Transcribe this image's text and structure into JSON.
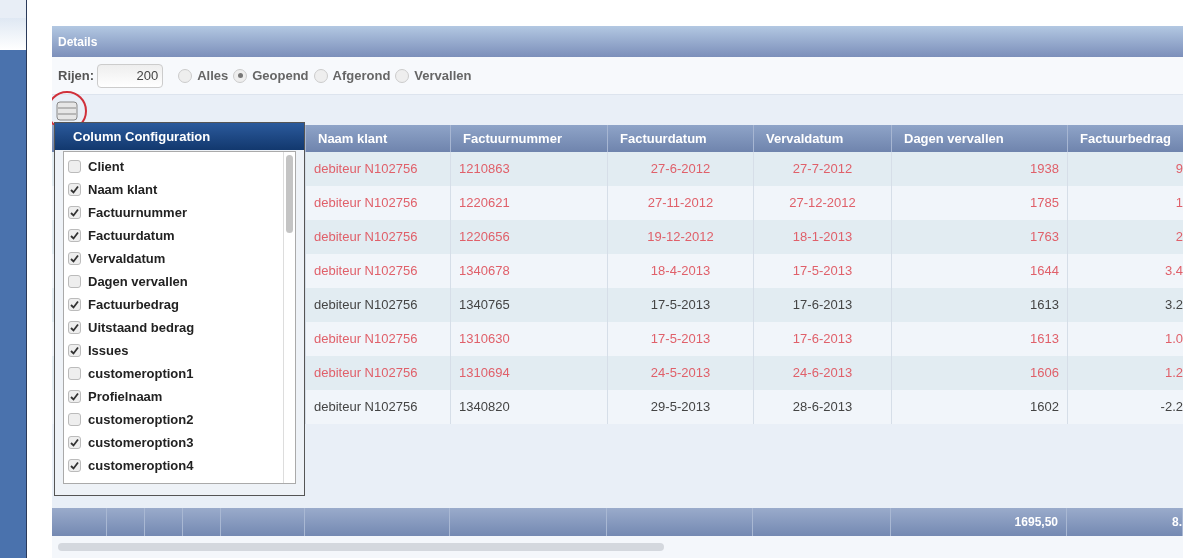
{
  "panel": {
    "title": "Details"
  },
  "toolbar": {
    "rows_label": "Rijen:",
    "rows_value": "200",
    "filters": [
      {
        "label": "Alles",
        "selected": false
      },
      {
        "label": "Geopend",
        "selected": true
      },
      {
        "label": "Afgerond",
        "selected": false
      },
      {
        "label": "Vervallen",
        "selected": false
      }
    ]
  },
  "column_config": {
    "title": "Column Configuration",
    "items": [
      {
        "label": "Client",
        "checked": false
      },
      {
        "label": "Naam klant",
        "checked": true
      },
      {
        "label": "Factuurnummer",
        "checked": true
      },
      {
        "label": "Factuurdatum",
        "checked": true
      },
      {
        "label": "Vervaldatum",
        "checked": true
      },
      {
        "label": "Dagen vervallen",
        "checked": false
      },
      {
        "label": "Factuurbedrag",
        "checked": true
      },
      {
        "label": "Uitstaand bedrag",
        "checked": true
      },
      {
        "label": "Issues",
        "checked": true
      },
      {
        "label": "customeroption1",
        "checked": false
      },
      {
        "label": "Profielnaam",
        "checked": true
      },
      {
        "label": "customeroption2",
        "checked": false
      },
      {
        "label": "customeroption3",
        "checked": true
      },
      {
        "label": "customeroption4",
        "checked": true
      }
    ]
  },
  "table": {
    "columns": [
      "Naam klant",
      "Factuurnummer",
      "Factuurdatum",
      "Vervaldatum",
      "Dagen vervallen",
      "Factuurbedrag"
    ],
    "rows": [
      {
        "alert": true,
        "cells": [
          "debiteur N102756",
          "1210863",
          "27-6-2012",
          "27-7-2012",
          "1938",
          "9"
        ]
      },
      {
        "alert": true,
        "cells": [
          "debiteur N102756",
          "1220621",
          "27-11-2012",
          "27-12-2012",
          "1785",
          "1"
        ]
      },
      {
        "alert": true,
        "cells": [
          "debiteur N102756",
          "1220656",
          "19-12-2012",
          "18-1-2013",
          "1763",
          "2"
        ]
      },
      {
        "alert": true,
        "cells": [
          "debiteur N102756",
          "1340678",
          "18-4-2013",
          "17-5-2013",
          "1644",
          "3.4"
        ]
      },
      {
        "alert": false,
        "cells": [
          "debiteur N102756",
          "1340765",
          "17-5-2013",
          "17-6-2013",
          "1613",
          "3.2"
        ]
      },
      {
        "alert": true,
        "cells": [
          "debiteur N102756",
          "1310630",
          "17-5-2013",
          "17-6-2013",
          "1613",
          "1.0"
        ]
      },
      {
        "alert": true,
        "cells": [
          "debiteur N102756",
          "1310694",
          "24-5-2013",
          "24-6-2013",
          "1606",
          "1.2"
        ]
      },
      {
        "alert": false,
        "cells": [
          "debiteur N102756",
          "1340820",
          "29-5-2013",
          "28-6-2013",
          "1602",
          "-2.2"
        ]
      }
    ],
    "footer": {
      "dagen_vervallen_total": "1695,50",
      "factuurbedrag_total": "8."
    }
  }
}
